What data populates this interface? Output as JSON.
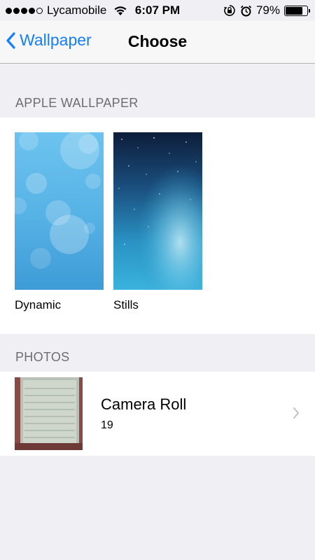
{
  "status_bar": {
    "carrier": "Lycamobile",
    "time": "6:07 PM",
    "battery_percent": "79%",
    "battery_level": 0.79,
    "signal_bars_filled": 4,
    "signal_bars_total": 5,
    "icons": [
      "wifi-icon",
      "rotation-lock-icon",
      "alarm-icon",
      "battery-icon"
    ]
  },
  "nav": {
    "back_label": "Wallpaper",
    "title": "Choose",
    "accent_color": "#147efb"
  },
  "sections": {
    "apple_wallpaper": "APPLE WALLPAPER",
    "photos": "PHOTOS"
  },
  "wallpapers": [
    {
      "label": "Dynamic"
    },
    {
      "label": "Stills"
    }
  ],
  "albums": [
    {
      "title": "Camera Roll",
      "count": "19",
      "icon": "chevron-right-icon"
    }
  ],
  "colors": {
    "background": "#efeff4",
    "section_text": "#6d6d72",
    "separator": "#b2b2b6"
  }
}
